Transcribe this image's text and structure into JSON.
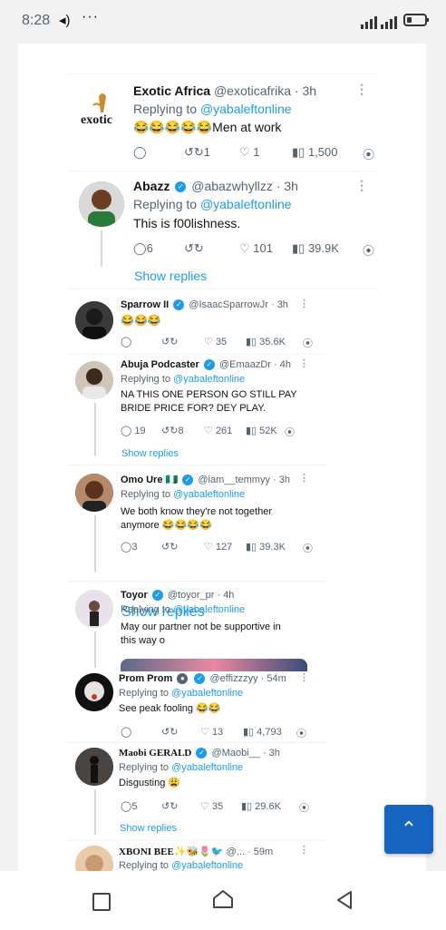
{
  "status": {
    "time": "8:28"
  },
  "tweets": [
    {
      "name": "Exotic Africa",
      "handle": "@exoticafrika",
      "time": "· 3h",
      "logo_text": "exotic",
      "replying_prefix": "Replying to",
      "replying_to": "@yabaleftonline",
      "text": "😂😂😂😂😂Men at work",
      "retweets": "1",
      "likes": "1",
      "views": "1,500"
    },
    {
      "name": "Abazz",
      "handle": "@abazwhyllzz",
      "time": "· 3h",
      "replying_prefix": "Replying to",
      "replying_to": "@yabaleftonline",
      "text": "This is f00lishness.",
      "replies": "6",
      "likes": "101",
      "views": "39.9K",
      "show_replies": "Show replies"
    },
    {
      "name": "Sparrow II",
      "handle": "@IsaacSparrowJr",
      "time": "· 3h",
      "text": "😂😂😂",
      "likes": "35",
      "views": "35.6K"
    },
    {
      "name": "Abuja Podcaster",
      "handle": "@EmaazDr",
      "time": "· 4h",
      "replying_prefix": "Replying to",
      "replying_to": "@yabaleftonline",
      "text_line1": "NA THIS ONE PERSON GO STILL PAY",
      "text_line2": "BRIDE PRICE FOR? DEY PLAY.",
      "replies": "19",
      "retweets": "8",
      "likes": "261",
      "views": "52K",
      "show_replies": "Show replies"
    },
    {
      "name": "Omo Ure 🇳🇬",
      "handle": "@iam__temmyy",
      "time": "· 3h",
      "replying_prefix": "Replying to",
      "replying_to": "@yabaleftonline",
      "text_line1": "We both know they're not together",
      "text_line2": "anymore 😂😂😂😂",
      "replies": "3",
      "likes": "127",
      "views": "39.3K",
      "show_replies": "Show replies"
    },
    {
      "name": "Toyor",
      "handle": "@toyor_pr",
      "time": "· 4h",
      "replying_prefix": "Replying to",
      "replying_to": "@yabaleftonline",
      "text_line1": "May our partner not be supportive in",
      "text_line2": "this way o"
    },
    {
      "name": "Prom Prom",
      "handle": "@effizzzyy",
      "time": "· 54m",
      "replying_prefix": "Replying to",
      "replying_to": "@yabaleftonline",
      "text": "See peak fooling 😂😂",
      "likes": "13",
      "views": "4,793"
    },
    {
      "name": "Maobi GERALD",
      "handle": "@Maobi__",
      "time": "· 3h",
      "replying_prefix": "Replying to",
      "replying_to": "@yabaleftonline",
      "text": "Disgusting 😩",
      "replies": "5",
      "likes": "35",
      "views": "29.6K",
      "show_replies": "Show replies"
    },
    {
      "name": "XBONI BEE✨🐝🌷🐦",
      "handle": "@...",
      "time": "· 59m",
      "replying_prefix": "Replying to",
      "replying_to": "@yabaleftonline"
    }
  ],
  "icons": {
    "reply": "reply-icon",
    "retweet": "retweet-icon",
    "like": "heart-icon",
    "views": "views-icon",
    "share": "share-icon",
    "scroll_top": "chevron-up-icon"
  },
  "colors": {
    "link": "#1d9bf0",
    "fab": "#1565c0"
  }
}
